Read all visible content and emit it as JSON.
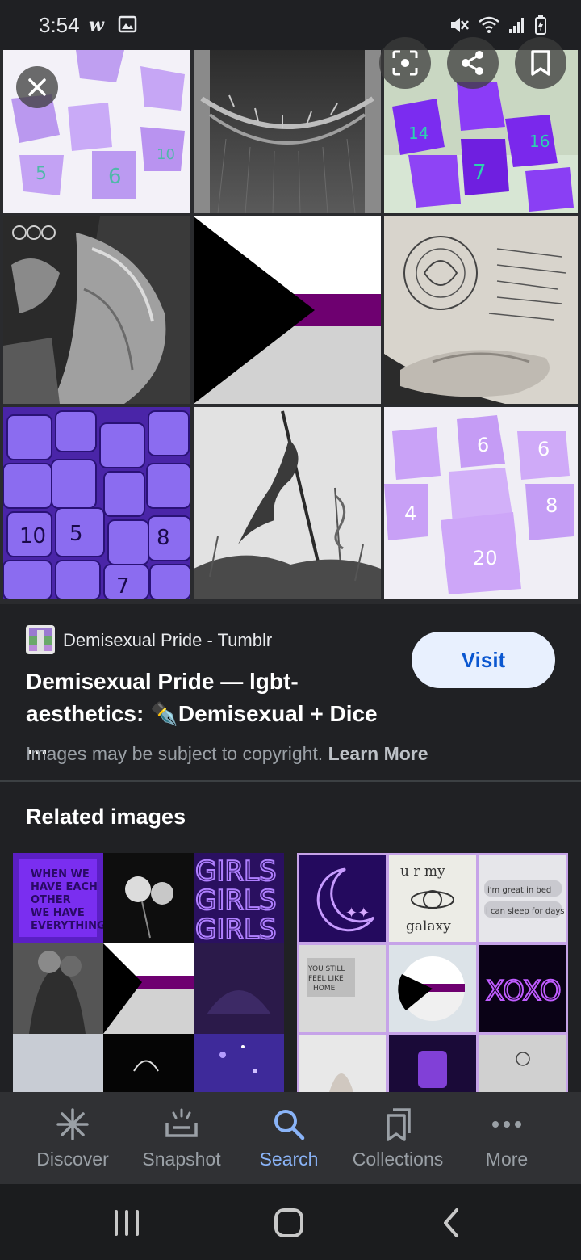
{
  "status_bar": {
    "time": "3:54"
  },
  "hero": {
    "close_icon": "close-icon",
    "lens_icon": "lens-icon",
    "share_icon": "share-icon",
    "bookmark_icon": "bookmark-icon"
  },
  "result": {
    "source_name": "Demisexual Pride - Tumblr",
    "title": "Demisexual Pride — lgbt-aesthetics: ✒️Demisexual + Dice …",
    "visit_label": "Visit",
    "copyright_text": "Images may be subject to copyright.",
    "learn_more": "Learn More"
  },
  "related": {
    "title": "Related images",
    "tile_a_words": [
      "GIRLS",
      "GIRLS",
      "GIRLS"
    ],
    "tile_a_note": "WHEN WE HAVE EACH OTHER WE HAVE EVERYTHING",
    "tile_b_texts": [
      "u r my galaxy",
      "i'm great in bed",
      "i can sleep for days",
      "YOU STILL FEEL LIKE HOME",
      "XOXO"
    ]
  },
  "bottom_nav": {
    "items": [
      {
        "label": "Discover",
        "icon": "asterisk-icon"
      },
      {
        "label": "Snapshot",
        "icon": "snapshot-icon"
      },
      {
        "label": "Search",
        "icon": "search-icon"
      },
      {
        "label": "Collections",
        "icon": "collections-icon"
      },
      {
        "label": "More",
        "icon": "more-icon"
      }
    ],
    "active": "Search"
  },
  "colors": {
    "background": "#202124",
    "accent": "#8ab4f8",
    "visit_bg": "#e8f0fe",
    "visit_text": "#0b57d0",
    "purple": "#800080"
  }
}
